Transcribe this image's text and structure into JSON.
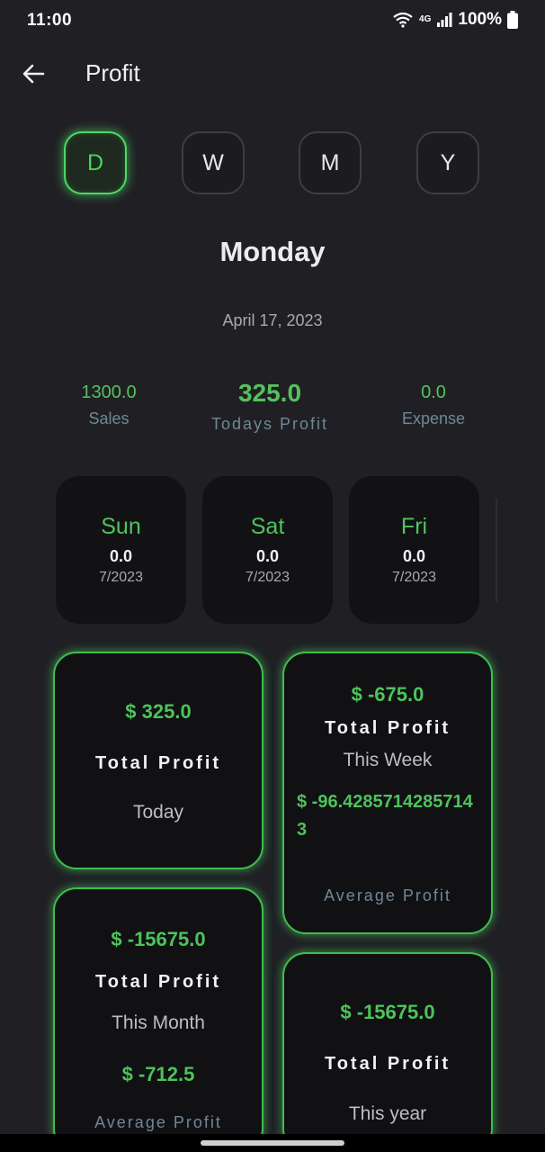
{
  "status_bar": {
    "time": "11:00",
    "network": "4G",
    "battery": "100%"
  },
  "app_bar": {
    "title": "Profit"
  },
  "periods": [
    "D",
    "W",
    "M",
    "Y"
  ],
  "selected_period": "D",
  "day": {
    "name": "Monday",
    "date": "April 17, 2023"
  },
  "summary": {
    "sales_value": "1300.0",
    "sales_label": "Sales",
    "profit_value": "325.0",
    "profit_label": "Todays Profit",
    "expense_value": "0.0",
    "expense_label": "Expense"
  },
  "days": [
    {
      "name": "Sun",
      "value": "0.0",
      "date": "7/2023"
    },
    {
      "name": "Sat",
      "value": "0.0",
      "date": "7/2023"
    },
    {
      "name": "Fri",
      "value": "0.0",
      "date": "7/2023"
    }
  ],
  "cards": {
    "today": {
      "amount": "$ 325.0",
      "title": "Total Profit",
      "sub": "Today"
    },
    "week": {
      "amount": "$ -675.0",
      "title": "Total Profit",
      "sub": "This Week",
      "avg_value": "$ -96.42857142857143",
      "avg_label": "Average Profit"
    },
    "month": {
      "amount": "$ -15675.0",
      "title": "Total Profit",
      "sub": "This Month",
      "avg_value": "$ -712.5",
      "avg_label": "Average Profit"
    },
    "year": {
      "amount": "$ -15675.0",
      "title": "Total Profit",
      "sub": "This year"
    }
  },
  "colors": {
    "accent": "#4cd964",
    "background": "#202024",
    "card": "#121215",
    "muted": "#6f8896"
  }
}
